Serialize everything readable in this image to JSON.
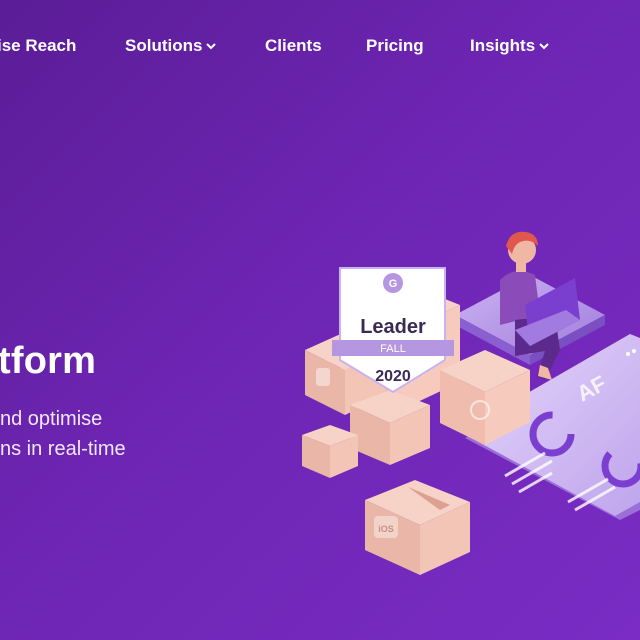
{
  "nav": {
    "items": [
      {
        "label": "ise Reach",
        "has_dropdown": false
      },
      {
        "label": "Solutions",
        "has_dropdown": true
      },
      {
        "label": "Clients",
        "has_dropdown": false
      },
      {
        "label": "Pricing",
        "has_dropdown": false
      },
      {
        "label": "Insights",
        "has_dropdown": true
      }
    ]
  },
  "hero": {
    "title": "tform",
    "subtitle_line1": "nd optimise",
    "subtitle_line2": "ns in real-time"
  },
  "badge": {
    "logo": "G",
    "title": "Leader",
    "season": "FALL",
    "year": "2020"
  },
  "box_label": "iOS",
  "screen_text": "AF",
  "colors": {
    "bg_start": "#5b1d97",
    "bg_end": "#7a2cc4",
    "box": "#f2c4b8",
    "badge_ribbon": "#b596e0",
    "accent_purple": "#7b3fd0"
  }
}
